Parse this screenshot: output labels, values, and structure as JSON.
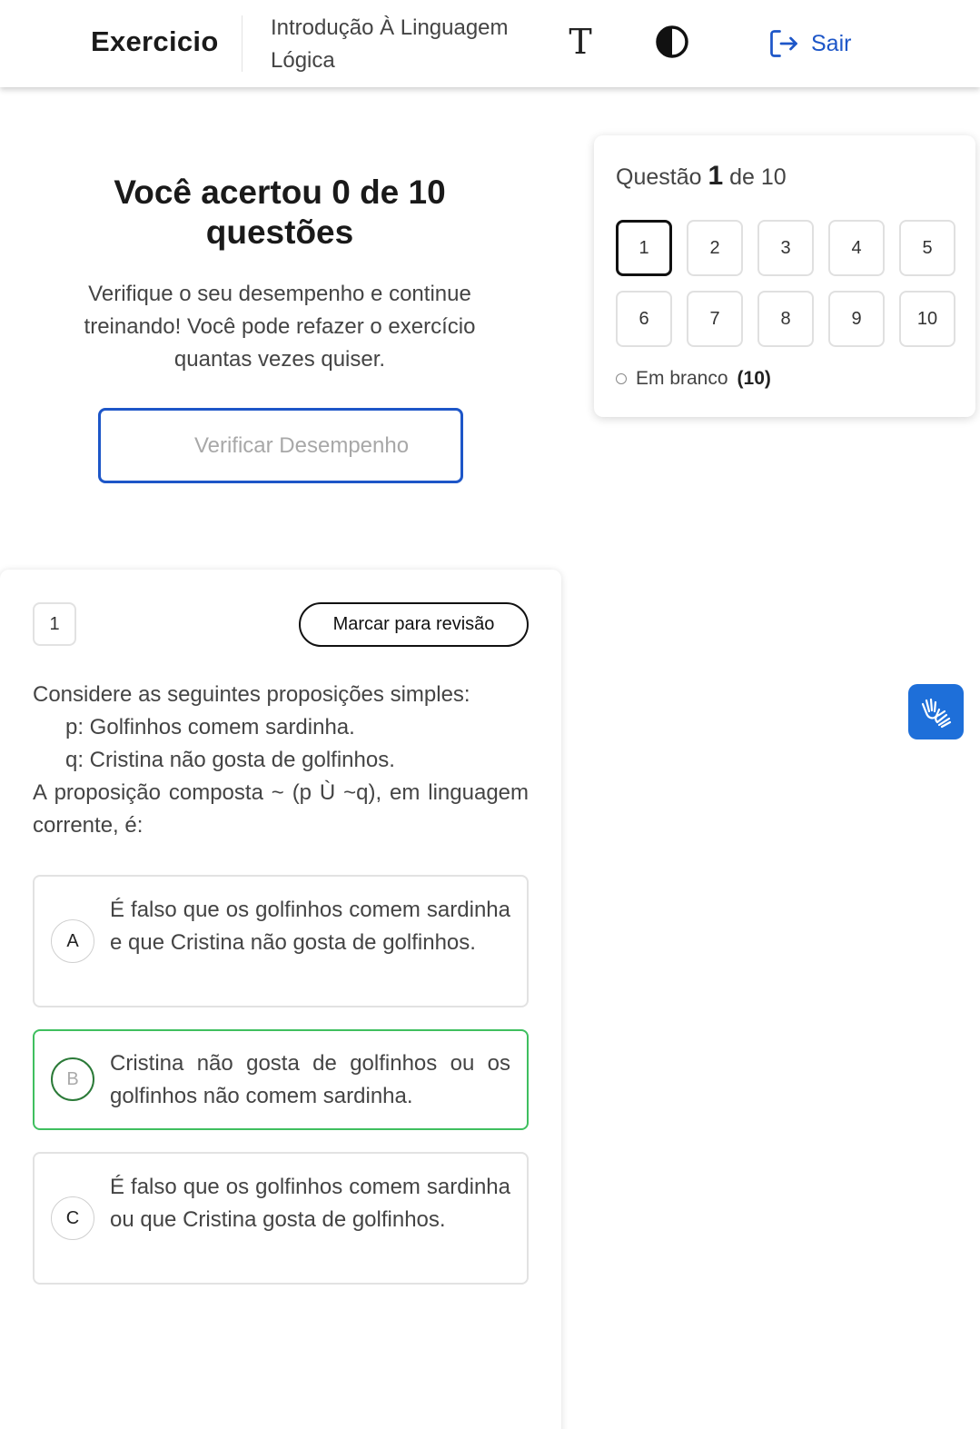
{
  "header": {
    "brand": "Exercicio",
    "course_title": "Introdução À Linguagem Lógica",
    "font_button_glyph": "T",
    "exit_label": "Sair",
    "icons": [
      "font-size-icon",
      "contrast-icon",
      "exit-icon"
    ]
  },
  "result": {
    "title": "Você acertou 0 de 10 questões",
    "subtitle": "Verifique o seu desempenho e continue treinando! Você pode refazer o exercício quantas vezes quiser.",
    "verify_button": "Verificar Desempenho"
  },
  "navigator": {
    "label_prefix": "Questão",
    "current": "1",
    "label_suffix": "de 10",
    "questions": [
      "1",
      "2",
      "3",
      "4",
      "5",
      "6",
      "7",
      "8",
      "9",
      "10"
    ],
    "blank_label": "Em branco",
    "blank_count": "(10)"
  },
  "question": {
    "number": "1",
    "review_button": "Marcar para revisão",
    "intro": "Considere as seguintes proposições simples:",
    "p": "p: Golfinhos comem sardinha.",
    "q": "q: Cristina não gosta de golfinhos.",
    "prompt": "A proposição composta ~ (p Ù ~q), em linguagem corrente, é:",
    "options": [
      {
        "letter": "A",
        "text": "É falso que os golfinhos comem sardinha e que Cristina não gosta de golfinhos."
      },
      {
        "letter": "B",
        "text": "Cristina não gosta de golfinhos ou os golfinhos não comem sardinha."
      },
      {
        "letter": "C",
        "text": "É falso que os golfinhos comem sardinha ou que Cristina gosta de golfinhos."
      }
    ]
  },
  "colors": {
    "primary": "#1d56c8",
    "correct_border": "#3fbf5f",
    "a11y_button": "#1e6fd9"
  }
}
